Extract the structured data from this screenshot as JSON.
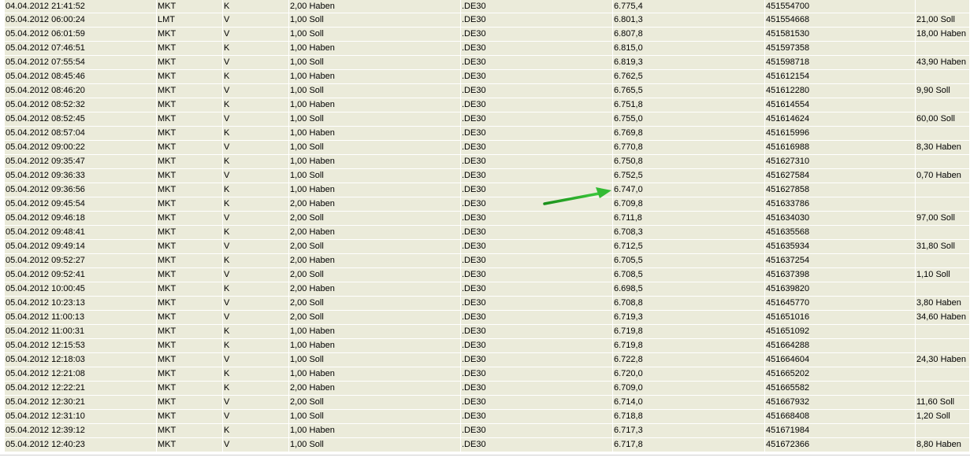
{
  "colors": {
    "row_bg": "#ebebda",
    "separator": "#ffffff",
    "arrow": "#22aa22"
  },
  "rows": [
    [
      "04.04.2012 21:41:52",
      "MKT",
      "K",
      "2,00 Haben",
      ".DE30",
      "6.775,4",
      "451554700",
      ""
    ],
    [
      "05.04.2012 06:00:24",
      "LMT",
      "V",
      "1,00 Soll",
      ".DE30",
      "6.801,3",
      "451554668",
      "21,00 Soll"
    ],
    [
      "05.04.2012 06:01:59",
      "MKT",
      "V",
      "1,00 Soll",
      ".DE30",
      "6.807,8",
      "451581530",
      "18,00 Haben"
    ],
    [
      "05.04.2012 07:46:51",
      "MKT",
      "K",
      "1,00 Haben",
      ".DE30",
      "6.815,0",
      "451597358",
      ""
    ],
    [
      "05.04.2012 07:55:54",
      "MKT",
      "V",
      "1,00 Soll",
      ".DE30",
      "6.819,3",
      "451598718",
      "43,90 Haben"
    ],
    [
      "05.04.2012 08:45:46",
      "MKT",
      "K",
      "1,00 Haben",
      ".DE30",
      "6.762,5",
      "451612154",
      ""
    ],
    [
      "05.04.2012 08:46:20",
      "MKT",
      "V",
      "1,00 Soll",
      ".DE30",
      "6.765,5",
      "451612280",
      "9,90 Soll"
    ],
    [
      "05.04.2012 08:52:32",
      "MKT",
      "K",
      "1,00 Haben",
      ".DE30",
      "6.751,8",
      "451614554",
      ""
    ],
    [
      "05.04.2012 08:52:45",
      "MKT",
      "V",
      "1,00 Soll",
      ".DE30",
      "6.755,0",
      "451614624",
      "60,00 Soll"
    ],
    [
      "05.04.2012 08:57:04",
      "MKT",
      "K",
      "1,00 Haben",
      ".DE30",
      "6.769,8",
      "451615996",
      ""
    ],
    [
      "05.04.2012 09:00:22",
      "MKT",
      "V",
      "1,00 Soll",
      ".DE30",
      "6.770,8",
      "451616988",
      "8,30 Haben"
    ],
    [
      "05.04.2012 09:35:47",
      "MKT",
      "K",
      "1,00 Haben",
      ".DE30",
      "6.750,8",
      "451627310",
      ""
    ],
    [
      "05.04.2012 09:36:33",
      "MKT",
      "V",
      "1,00 Soll",
      ".DE30",
      "6.752,5",
      "451627584",
      "0,70 Haben"
    ],
    [
      "05.04.2012 09:36:56",
      "MKT",
      "K",
      "1,00 Haben",
      ".DE30",
      "6.747,0",
      "451627858",
      ""
    ],
    [
      "05.04.2012 09:45:54",
      "MKT",
      "K",
      "2,00 Haben",
      ".DE30",
      "6.709,8",
      "451633786",
      ""
    ],
    [
      "05.04.2012 09:46:18",
      "MKT",
      "V",
      "2,00 Soll",
      ".DE30",
      "6.711,8",
      "451634030",
      "97,00 Soll"
    ],
    [
      "05.04.2012 09:48:41",
      "MKT",
      "K",
      "2,00 Haben",
      ".DE30",
      "6.708,3",
      "451635568",
      ""
    ],
    [
      "05.04.2012 09:49:14",
      "MKT",
      "V",
      "2,00 Soll",
      ".DE30",
      "6.712,5",
      "451635934",
      "31,80 Soll"
    ],
    [
      "05.04.2012 09:52:27",
      "MKT",
      "K",
      "2,00 Haben",
      ".DE30",
      "6.705,5",
      "451637254",
      ""
    ],
    [
      "05.04.2012 09:52:41",
      "MKT",
      "V",
      "2,00 Soll",
      ".DE30",
      "6.708,5",
      "451637398",
      "1,10 Soll"
    ],
    [
      "05.04.2012 10:00:45",
      "MKT",
      "K",
      "2,00 Haben",
      ".DE30",
      "6.698,5",
      "451639820",
      ""
    ],
    [
      "05.04.2012 10:23:13",
      "MKT",
      "V",
      "2,00 Soll",
      ".DE30",
      "6.708,8",
      "451645770",
      "3,80 Haben"
    ],
    [
      "05.04.2012 11:00:13",
      "MKT",
      "V",
      "2,00 Soll",
      ".DE30",
      "6.719,3",
      "451651016",
      "34,60 Haben"
    ],
    [
      "05.04.2012 11:00:31",
      "MKT",
      "K",
      "1,00 Haben",
      ".DE30",
      "6.719,8",
      "451651092",
      ""
    ],
    [
      "05.04.2012 12:15:53",
      "MKT",
      "K",
      "1,00 Haben",
      ".DE30",
      "6.719,8",
      "451664288",
      ""
    ],
    [
      "05.04.2012 12:18:03",
      "MKT",
      "V",
      "1,00 Soll",
      ".DE30",
      "6.722,8",
      "451664604",
      "24,30 Haben"
    ],
    [
      "05.04.2012 12:21:08",
      "MKT",
      "K",
      "1,00 Haben",
      ".DE30",
      "6.720,0",
      "451665202",
      ""
    ],
    [
      "05.04.2012 12:22:21",
      "MKT",
      "K",
      "2,00 Haben",
      ".DE30",
      "6.709,0",
      "451665582",
      ""
    ],
    [
      "05.04.2012 12:30:21",
      "MKT",
      "V",
      "2,00 Soll",
      ".DE30",
      "6.714,0",
      "451667932",
      "11,60 Soll"
    ],
    [
      "05.04.2012 12:31:10",
      "MKT",
      "V",
      "1,00 Soll",
      ".DE30",
      "6.718,8",
      "451668408",
      "1,20 Soll"
    ],
    [
      "05.04.2012 12:39:12",
      "MKT",
      "K",
      "1,00 Haben",
      ".DE30",
      "6.717,3",
      "451671984",
      ""
    ],
    [
      "05.04.2012 12:40:23",
      "MKT",
      "V",
      "1,00 Soll",
      ".DE30",
      "6.717,8",
      "451672366",
      "8,80 Haben"
    ]
  ],
  "arrow": {
    "icon": "arrow-annotation-icon",
    "points_to_row": 13
  }
}
